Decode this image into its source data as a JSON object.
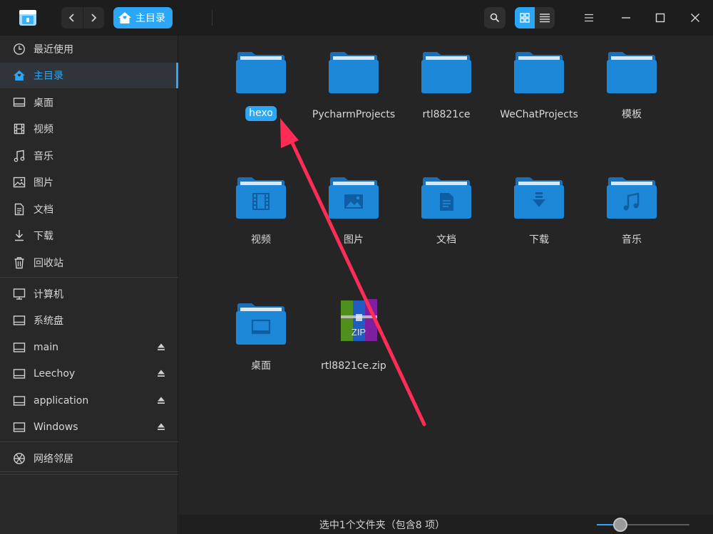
{
  "titlebar": {
    "breadcrumb": "主目录",
    "icons": {
      "back": "chevron-left-icon",
      "forward": "chevron-right-icon",
      "search": "search-icon",
      "grid_view": "grid-view-icon",
      "list_view": "list-view-icon",
      "menu": "menu-icon",
      "minimize": "minimize-icon",
      "maximize": "maximize-icon",
      "close": "close-icon"
    },
    "accent": "#2ca7f8"
  },
  "sidebar": {
    "items": [
      {
        "label": "最近使用",
        "icon": "clock-icon"
      },
      {
        "label": "主目录",
        "icon": "home-icon",
        "active": true
      },
      {
        "label": "桌面",
        "icon": "desktop-icon"
      },
      {
        "label": "视频",
        "icon": "film-icon"
      },
      {
        "label": "音乐",
        "icon": "music-icon"
      },
      {
        "label": "图片",
        "icon": "image-icon"
      },
      {
        "label": "文档",
        "icon": "document-icon"
      },
      {
        "label": "下载",
        "icon": "download-icon"
      },
      {
        "label": "回收站",
        "icon": "trash-icon"
      }
    ],
    "devices": [
      {
        "label": "计算机",
        "icon": "computer-icon"
      },
      {
        "label": "系统盘",
        "icon": "disk-icon"
      },
      {
        "label": "main",
        "icon": "disk-icon",
        "eject": true
      },
      {
        "label": "Leechoy",
        "icon": "disk-icon",
        "eject": true
      },
      {
        "label": "application",
        "icon": "disk-icon",
        "eject": true
      },
      {
        "label": "Windows",
        "icon": "disk-icon",
        "eject": true
      }
    ],
    "network": {
      "label": "网络邻居",
      "icon": "network-icon"
    }
  },
  "files": [
    {
      "name": "hexo",
      "type": "folder",
      "selected": true
    },
    {
      "name": "PycharmProjects",
      "type": "folder"
    },
    {
      "name": "rtl8821ce",
      "type": "folder"
    },
    {
      "name": "WeChatProjects",
      "type": "folder"
    },
    {
      "name": "模板",
      "type": "folder"
    },
    {
      "name": "视频",
      "type": "folder",
      "emblem": "film-icon"
    },
    {
      "name": "图片",
      "type": "folder",
      "emblem": "image-icon"
    },
    {
      "name": "文档",
      "type": "folder",
      "emblem": "document-icon"
    },
    {
      "name": "下载",
      "type": "folder",
      "emblem": "download-icon"
    },
    {
      "name": "音乐",
      "type": "folder",
      "emblem": "music-icon"
    },
    {
      "name": "桌面",
      "type": "folder",
      "emblem": "desktop-icon"
    },
    {
      "name": "rtl8821ce.zip",
      "type": "archive",
      "badge": "ZIP"
    }
  ],
  "statusbar": {
    "text": "选中1个文件夹（包含8 项）",
    "zoom_level": 0.25
  },
  "annotation": {
    "color": "#ff2d55"
  }
}
